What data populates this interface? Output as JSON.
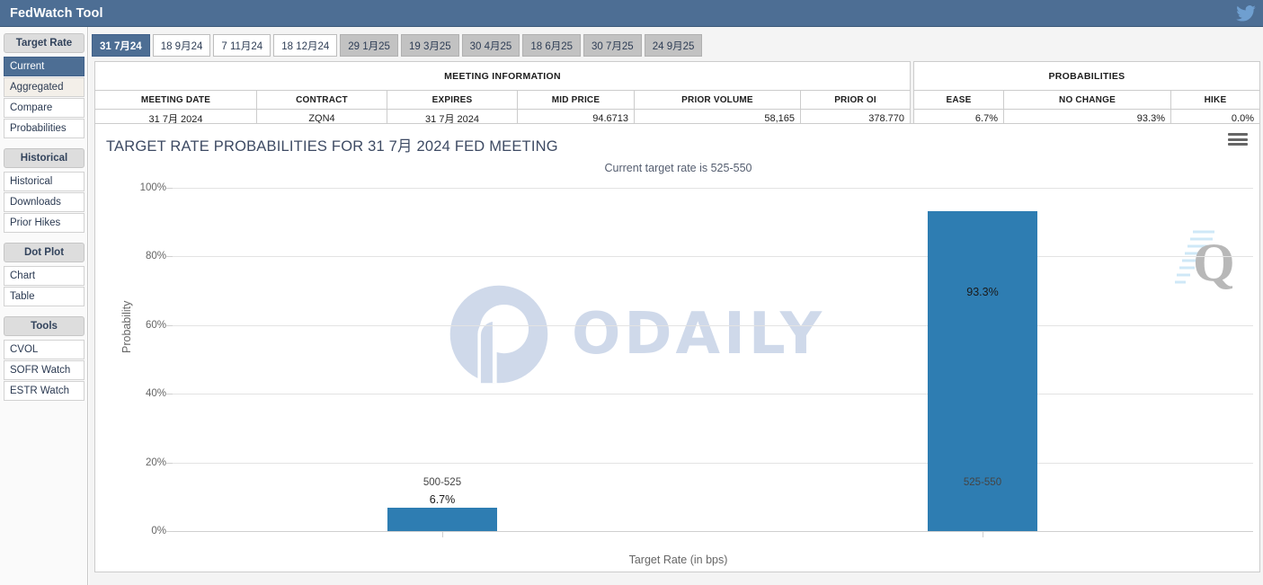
{
  "window": {
    "title": "FedWatch Tool",
    "twitter_icon": "twitter-bird-icon",
    "titlebar_color": "#4d6e94"
  },
  "sidebar": {
    "groups": [
      {
        "header": "Target Rate",
        "items": [
          {
            "label": "Current",
            "selected": true
          },
          {
            "label": "Aggregated",
            "selected": false
          },
          {
            "label": "Compare",
            "selected": false
          },
          {
            "label": "Probabilities",
            "selected": false
          }
        ]
      },
      {
        "header": "Historical",
        "items": [
          {
            "label": "Historical",
            "selected": false
          },
          {
            "label": "Downloads",
            "selected": false
          },
          {
            "label": "Prior Hikes",
            "selected": false
          }
        ]
      },
      {
        "header": "Dot Plot",
        "items": [
          {
            "label": "Chart",
            "selected": false
          },
          {
            "label": "Table",
            "selected": false
          }
        ]
      },
      {
        "header": "Tools",
        "items": [
          {
            "label": "CVOL",
            "selected": false
          },
          {
            "label": "SOFR Watch",
            "selected": false
          },
          {
            "label": "ESTR Watch",
            "selected": false
          }
        ]
      }
    ]
  },
  "tabs": [
    {
      "label": "31 7月24",
      "state": "active"
    },
    {
      "label": "18 9月24",
      "state": "white"
    },
    {
      "label": "7 11月24",
      "state": "white"
    },
    {
      "label": "18 12月24",
      "state": "white"
    },
    {
      "label": "29 1月25",
      "state": "grey"
    },
    {
      "label": "19 3月25",
      "state": "grey"
    },
    {
      "label": "30 4月25",
      "state": "grey"
    },
    {
      "label": "18 6月25",
      "state": "grey"
    },
    {
      "label": "30 7月25",
      "state": "grey"
    },
    {
      "label": "24 9月25",
      "state": "grey"
    }
  ],
  "meeting_information": {
    "title": "MEETING INFORMATION",
    "headers": [
      "MEETING DATE",
      "CONTRACT",
      "EXPIRES",
      "MID PRICE",
      "PRIOR VOLUME",
      "PRIOR OI"
    ],
    "values": [
      "31 7月 2024",
      "ZQN4",
      "31 7月 2024",
      "94.6713",
      "58,165",
      "378.770"
    ]
  },
  "probabilities_table": {
    "title": "PROBABILITIES",
    "headers": [
      "EASE",
      "NO CHANGE",
      "HIKE"
    ],
    "values": [
      "6.7%",
      "93.3%",
      "0.0%"
    ]
  },
  "chart_panel": {
    "title": "TARGET RATE PROBABILITIES FOR 31 7月 2024 FED MEETING",
    "subtitle": "Current target rate is 525-550",
    "menu_icon": "hamburger-menu-icon"
  },
  "chart_data": {
    "type": "bar",
    "title": "TARGET RATE PROBABILITIES FOR 31 7月 2024 FED MEETING",
    "subtitle": "Current target rate is 525-550",
    "categories": [
      "500-525",
      "525-550"
    ],
    "values": [
      6.7,
      93.3
    ],
    "data_labels": [
      "6.7%",
      "93.3%"
    ],
    "xlabel": "Target Rate (in bps)",
    "ylabel": "Probability",
    "ylim": [
      0,
      100
    ],
    "yticks": [
      0,
      20,
      40,
      60,
      80,
      100
    ],
    "ytick_labels": [
      "0%",
      "20%",
      "40%",
      "60%",
      "80%",
      "100%"
    ],
    "grid": true,
    "legend": "none",
    "bar_color": "#2e7db2"
  },
  "watermarks": {
    "primary": "ODAILY",
    "primary_color": "#a9bbd9",
    "secondary": "Q"
  }
}
